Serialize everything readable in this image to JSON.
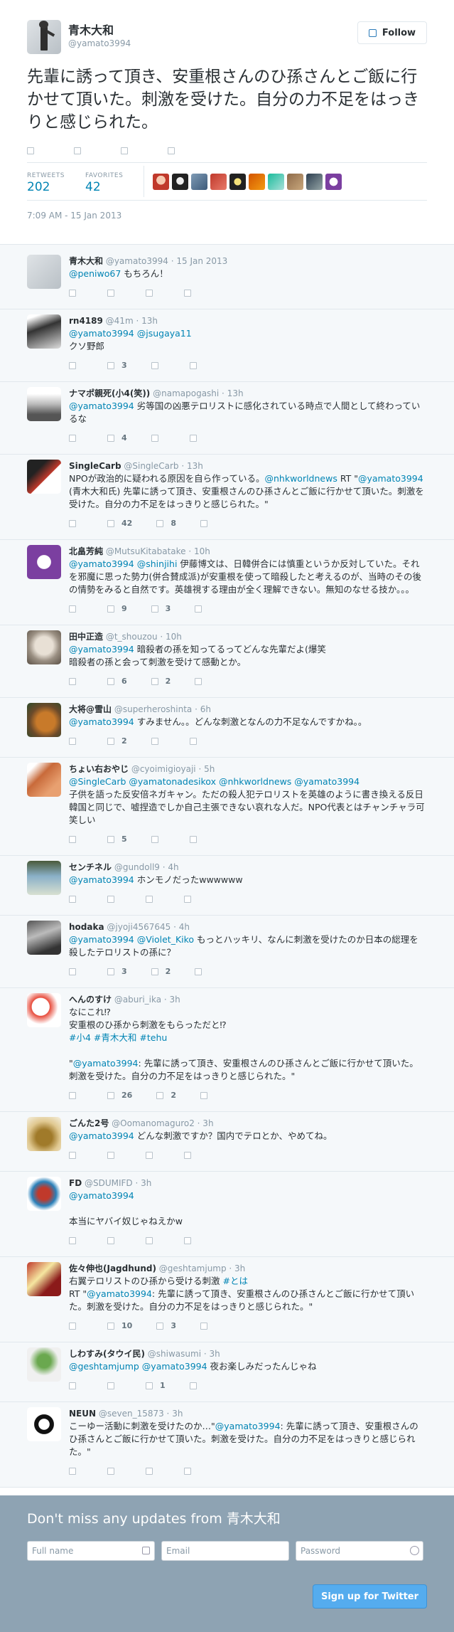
{
  "tweet": {
    "name": "青木大和",
    "screen_name": "@yamato3994",
    "follow_label": "Follow",
    "text": "先輩に誘って頂き、安重根さんのひ孫さんとご飯に行かせて頂いた。刺激を受けた。自分の力不足をはっきりと感じられた。",
    "retweets_label": "RETWEETS",
    "retweets": "202",
    "favorites_label": "FAVORITES",
    "favorites": "42",
    "timestamp": "7:09 AM - 15 Jan 2013"
  },
  "colors": {
    "link": "#0084b4",
    "bg": "#f5f8fa",
    "signup_bg": "#8ea3b3",
    "button": "#55acee"
  },
  "replies": [
    {
      "name": "青木大和",
      "handle": "@yamato3994",
      "time": "15 Jan 2013",
      "parts": [
        [
          "@peniwo67",
          "l"
        ],
        [
          " もちろん！",
          ""
        ]
      ],
      "rt": "",
      "fav": ""
    },
    {
      "name": "rn4189",
      "handle": "@41m",
      "time": "13h",
      "parts": [
        [
          "@yamato3994",
          "l"
        ],
        [
          " ",
          ""
        ],
        [
          "@jsugaya11",
          "l"
        ],
        [
          "\nクソ野郎",
          ""
        ]
      ],
      "rt": "3",
      "fav": ""
    },
    {
      "name": "ナマポ親死(小4(笑))",
      "handle": "@namapogashi",
      "time": "13h",
      "parts": [
        [
          "@yamato3994",
          "l"
        ],
        [
          " 劣等国の凶悪テロリストに感化されている時点で人間として終わっているな",
          ""
        ]
      ],
      "rt": "4",
      "fav": ""
    },
    {
      "name": "SingleCarb",
      "handle": "@SingleCarb",
      "time": "13h",
      "parts": [
        [
          "NPOが政治的に疑われる原因を自ら作っている。",
          ""
        ],
        [
          "@nhkworldnews",
          "l"
        ],
        [
          " RT \"",
          ""
        ],
        [
          "@yamato3994",
          "l"
        ],
        [
          " (青木大和氏) 先輩に誘って頂き、安重根さんのひ孫さんとご飯に行かせて頂いた。刺激を受けた。自分の力不足をはっきりと感じられた。\"",
          ""
        ]
      ],
      "rt": "42",
      "fav": "8"
    },
    {
      "name": "北畠芳純",
      "handle": "@MutsuKitabatake",
      "time": "10h",
      "parts": [
        [
          "@yamato3994",
          "l"
        ],
        [
          " ",
          ""
        ],
        [
          "@shinjihi",
          "l"
        ],
        [
          " 伊藤博文は、日韓併合には慎重というか反対していた。それを邪魔に思った勢力(併合賛成派)が安重根を使って暗殺したと考えるのが、当時のその後の情勢をみると自然です。英雄視する理由が全く理解できない。無知のなせる技か。。。",
          ""
        ]
      ],
      "rt": "9",
      "fav": "3"
    },
    {
      "name": "田中正造",
      "handle": "@t_shouzou",
      "time": "10h",
      "parts": [
        [
          "@yamato3994",
          "l"
        ],
        [
          " 暗殺者の孫を知ってるってどんな先輩だよ(爆笑\n暗殺者の孫と会って刺激を受けて感動とか。",
          ""
        ]
      ],
      "rt": "6",
      "fav": "2"
    },
    {
      "name": "大将@雪山",
      "handle": "@superheroshinta",
      "time": "6h",
      "parts": [
        [
          "@yamato3994",
          "l"
        ],
        [
          " すみません。。どんな刺激となんの力不足なんですかね。。",
          ""
        ]
      ],
      "rt": "2",
      "fav": ""
    },
    {
      "name": "ちょい右おやじ",
      "handle": "@cyoimigioyaji",
      "time": "5h",
      "parts": [
        [
          "@SingleCarb",
          "l"
        ],
        [
          " ",
          ""
        ],
        [
          "@yamatonadesikox",
          "l"
        ],
        [
          " ",
          ""
        ],
        [
          "@nhkworldnews",
          "l"
        ],
        [
          " ",
          ""
        ],
        [
          "@yamato3994",
          "l"
        ],
        [
          "\n子供を語った反安倍ネガキャン。ただの殺人犯テロリストを英雄のように書き換える反日韓国と同じで、嘘捏造でしか自己主張できない哀れな人だ。NPO代表とはチャンチャラ可笑しい",
          ""
        ]
      ],
      "rt": "5",
      "fav": ""
    },
    {
      "name": "センチネル",
      "handle": "@gundoll9",
      "time": "4h",
      "parts": [
        [
          "@yamato3994",
          "l"
        ],
        [
          " ホンモノだったwwwwww",
          ""
        ]
      ],
      "rt": "",
      "fav": ""
    },
    {
      "name": "hodaka",
      "handle": "@jyoji4567645",
      "time": "4h",
      "parts": [
        [
          "@yamato3994",
          "l"
        ],
        [
          " ",
          ""
        ],
        [
          "@Violet_Kiko",
          "l"
        ],
        [
          " もっとハッキリ、なんに刺激を受けたのか日本の総理を殺したテロリストの孫に？",
          ""
        ]
      ],
      "rt": "3",
      "fav": "2"
    },
    {
      "name": "へんのすけ",
      "handle": "@aburi_ika",
      "time": "3h",
      "parts": [
        [
          "なにこれ⁉︎\n安重根のひ孫から刺激をもらっただと⁉︎\n",
          ""
        ],
        [
          "#小4",
          "l"
        ],
        [
          " ",
          ""
        ],
        [
          "#青木大和",
          "l"
        ],
        [
          " ",
          ""
        ],
        [
          "#tehu",
          "l"
        ],
        [
          "\n\n\"",
          ""
        ],
        [
          "@yamato3994",
          "l"
        ],
        [
          ": 先輩に誘って頂き、安重根さんのひ孫さんとご飯に行かせて頂いた。刺激を受けた。自分の力不足をはっきりと感じられた。\"",
          ""
        ]
      ],
      "rt": "26",
      "fav": "2"
    },
    {
      "name": "ごんた2号",
      "handle": "@Oomanomaguro2",
      "time": "3h",
      "parts": [
        [
          "@yamato3994",
          "l"
        ],
        [
          " どんな刺激ですか？国内でテロとか、やめてね。",
          ""
        ]
      ],
      "rt": "",
      "fav": ""
    },
    {
      "name": "FD",
      "handle": "@SDUMIFD",
      "time": "3h",
      "parts": [
        [
          "@yamato3994",
          "l"
        ],
        [
          "\n\n本当にヤバイ奴じゃねえかw",
          ""
        ]
      ],
      "rt": "",
      "fav": ""
    },
    {
      "name": "佐々伸也(Jagdhund)",
      "handle": "@geshtamjump",
      "time": "3h",
      "parts": [
        [
          "右翼テロリストのひ孫から受ける刺激 ",
          ""
        ],
        [
          "#とは",
          "l"
        ],
        [
          "\nRT \"",
          ""
        ],
        [
          "@yamato3994",
          "l"
        ],
        [
          ": 先輩に誘って頂き、安重根さんのひ孫さんとご飯に行かせて頂いた。刺激を受けた。自分の力不足をはっきりと感じられた。\"",
          ""
        ]
      ],
      "rt": "10",
      "fav": "3"
    },
    {
      "name": "しわすみ(タウイ民)",
      "handle": "@shiwasumi",
      "time": "3h",
      "parts": [
        [
          "@geshtamjump",
          "l"
        ],
        [
          " ",
          ""
        ],
        [
          "@yamato3994",
          "l"
        ],
        [
          " 夜お楽しみだったんじゃね",
          ""
        ]
      ],
      "rt": "",
      "fav": "1"
    },
    {
      "name": "NEUN",
      "handle": "@seven_15873",
      "time": "3h",
      "parts": [
        [
          "こーゆー活動に刺激を受けたのか…\"",
          ""
        ],
        [
          "@yamato3994",
          "l"
        ],
        [
          ": 先輩に誘って頂き、安重根さんのひ孫さんとご飯に行かせて頂いた。刺激を受けた。自分の力不足をはっきりと感じられた。\"",
          ""
        ]
      ],
      "rt": "",
      "fav": ""
    }
  ],
  "signup": {
    "title": "Don't miss any updates from 青木大和",
    "name_placeholder": "Full name",
    "email_placeholder": "Email",
    "password_placeholder": "Password",
    "button": "Sign up for Twitter"
  }
}
